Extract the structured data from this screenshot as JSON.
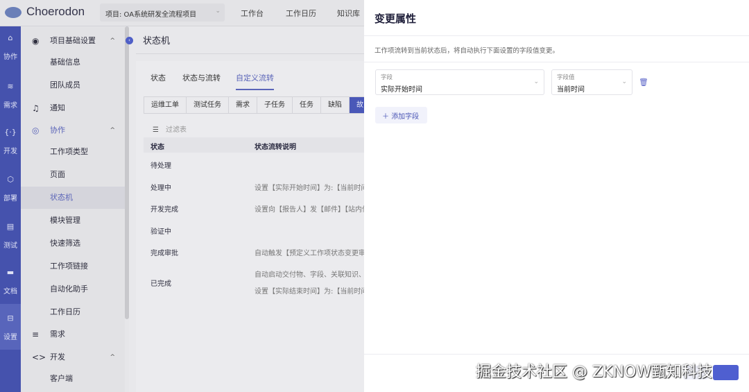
{
  "app": {
    "name": "Choerodon",
    "project": "项目: OA系统研发全流程项目",
    "nav": [
      "工作台",
      "工作日历",
      "知识库"
    ]
  },
  "rail": [
    {
      "label": "协作",
      "icon": "collab-icon"
    },
    {
      "label": "需求",
      "icon": "layers-icon"
    },
    {
      "label": "开发",
      "icon": "code-icon"
    },
    {
      "label": "部署",
      "icon": "deploy-icon"
    },
    {
      "label": "测试",
      "icon": "test-icon"
    },
    {
      "label": "文档",
      "icon": "doc-icon"
    },
    {
      "label": "设置",
      "icon": "settings-icon"
    }
  ],
  "sidebar": {
    "items": [
      {
        "label": "项目基础设置",
        "icon": "palette-icon",
        "caret": "^"
      },
      {
        "label": "基础信息"
      },
      {
        "label": "团队成员"
      },
      {
        "label": "通知",
        "icon": "bell-icon"
      },
      {
        "label": "协作",
        "icon": "collab-icon",
        "caret": "^"
      },
      {
        "label": "工作项类型"
      },
      {
        "label": "页面"
      },
      {
        "label": "状态机"
      },
      {
        "label": "模块管理"
      },
      {
        "label": "快速筛选"
      },
      {
        "label": "工作项链接"
      },
      {
        "label": "自动化助手"
      },
      {
        "label": "工作日历"
      },
      {
        "label": "需求",
        "icon": "menu-icon"
      },
      {
        "label": "开发",
        "icon": "code-icon",
        "caret": "^"
      },
      {
        "label": "客户端"
      }
    ]
  },
  "main": {
    "title": "状态机",
    "tabs": [
      "状态",
      "状态与流转",
      "自定义流转"
    ],
    "issue_types": [
      "运维工单",
      "测试任务",
      "需求",
      "子任务",
      "任务",
      "缺陷",
      "故"
    ],
    "filter_placeholder": "过滤表",
    "columns": [
      "状态",
      "状态流转说明"
    ],
    "rows": [
      {
        "status": "待处理",
        "desc": []
      },
      {
        "status": "处理中",
        "desc": [
          "设置【实际开始时间】为:【当前时间】"
        ]
      },
      {
        "status": "开发完成",
        "desc": [
          "设置向【报告人】发【邮件】【站内信】"
        ]
      },
      {
        "status": "验证中",
        "desc": []
      },
      {
        "status": "完成审批",
        "desc": [
          "自动触发【预定义工作项状态变更审批】"
        ]
      },
      {
        "status": "已完成",
        "desc": [
          "自动启动交付物、字段、关联知识、附件",
          "设置【实际结束时间】为:【当前时间】"
        ]
      }
    ]
  },
  "panel": {
    "title": "变更属性",
    "description": "工作项流转到当前状态后，将自动执行下面设置的字段值变更。",
    "field": {
      "label": "字段",
      "value": "实际开始时间"
    },
    "field_value": {
      "label": "字段值",
      "value": "当前时间"
    },
    "add_field": "添加字段"
  },
  "watermark": "掘金技术社区 @ ZKNOW甄知科技"
}
